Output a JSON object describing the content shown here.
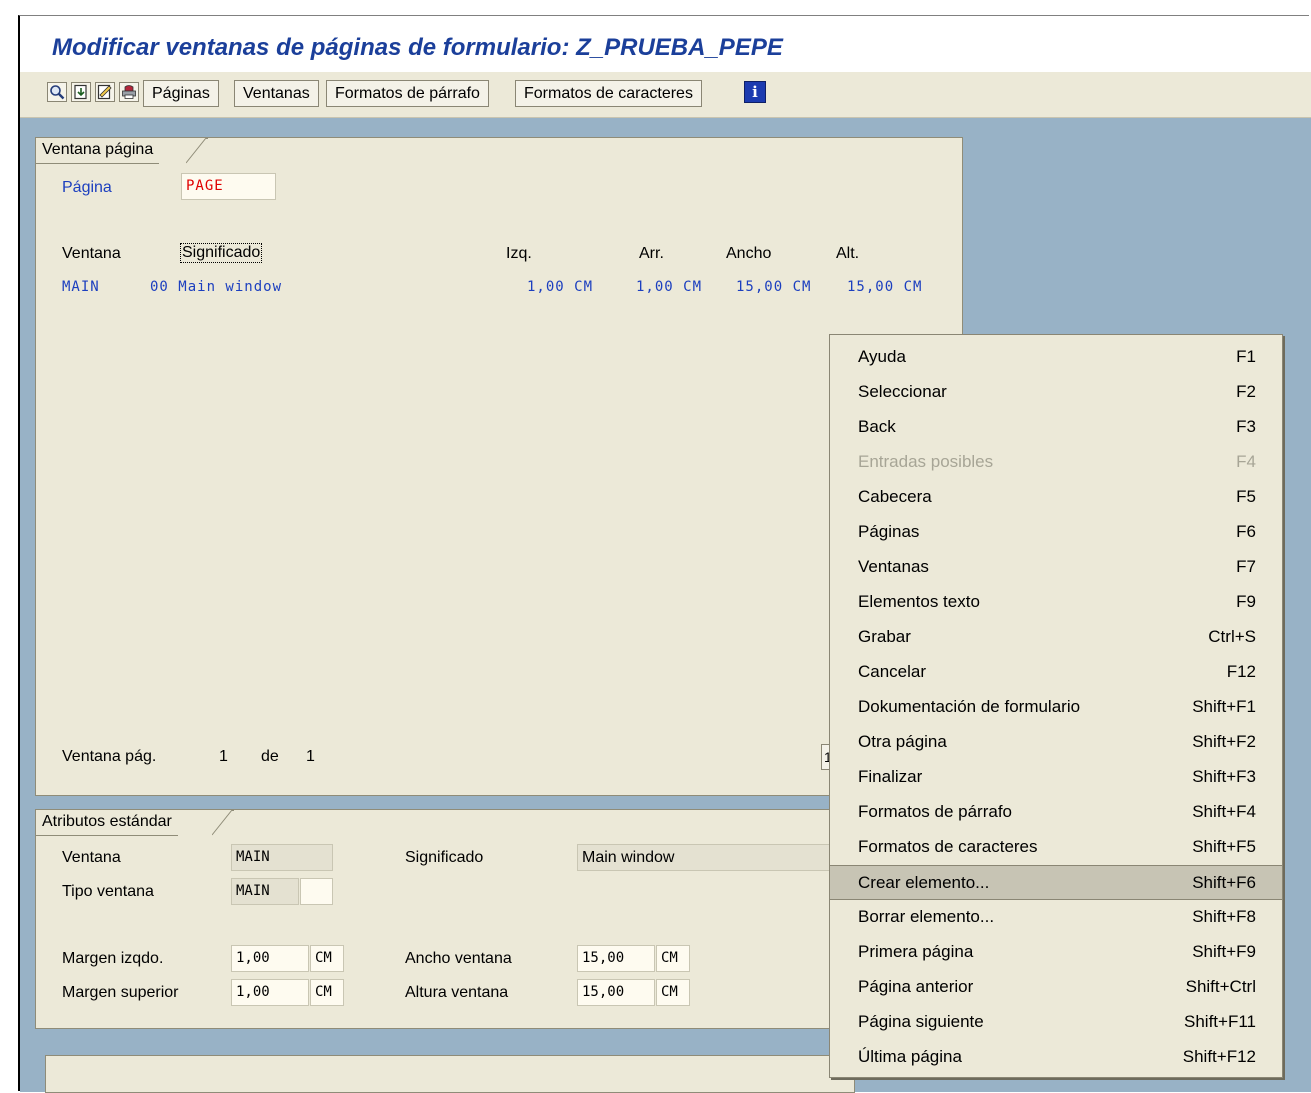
{
  "title": "Modificar ventanas de páginas de formulario: Z_PRUEBA_PEPE",
  "toolbar": {
    "buttons": [
      "Páginas",
      "Ventanas",
      "Formatos de párrafo",
      "Formatos de caracteres"
    ],
    "icons": [
      "magnifier-icon",
      "save-document-icon",
      "edit-pencil-icon",
      "print-icon",
      "info-icon"
    ],
    "info_glyph": "i"
  },
  "page_window": {
    "tab_label": "Ventana página",
    "page_label": "Página",
    "page_value": "PAGE",
    "headers": {
      "ventana": "Ventana",
      "significado": "Significado",
      "izq": "Izq.",
      "arr": "Arr.",
      "ancho": "Ancho",
      "alt": "Alt."
    },
    "rows": [
      {
        "ventana": "MAIN",
        "significado": "00 Main window",
        "izq": "1,00 CM",
        "arr": "1,00 CM",
        "ancho": "15,00 CM",
        "alt": "15,00 CM"
      }
    ],
    "pager": {
      "label": "Ventana pág.",
      "current": "1",
      "of": "de",
      "total": "1"
    },
    "partial_button": "1"
  },
  "attributes": {
    "tab_label": "Atributos estándar",
    "ventana_label": "Ventana",
    "ventana_value": "MAIN",
    "significado_label": "Significado",
    "significado_value": "Main window",
    "tipo_label": "Tipo ventana",
    "tipo_value": "MAIN",
    "margen_izq_label": "Margen izqdo.",
    "margen_izq_value": "1,00",
    "margen_izq_unit": "CM",
    "margen_sup_label": "Margen superior",
    "margen_sup_value": "1,00",
    "margen_sup_unit": "CM",
    "ancho_label": "Ancho ventana",
    "ancho_value": "15,00",
    "ancho_unit": "CM",
    "altura_label": "Altura ventana",
    "altura_value": "15,00",
    "altura_unit": "CM"
  },
  "context_menu": {
    "items": [
      {
        "label": "Ayuda",
        "key": "F1"
      },
      {
        "label": "Seleccionar",
        "key": "F2"
      },
      {
        "label": "Back",
        "key": "F3"
      },
      {
        "label": "Entradas posibles",
        "key": "F4",
        "disabled": true
      },
      {
        "label": "Cabecera",
        "key": "F5"
      },
      {
        "label": "Páginas",
        "key": "F6"
      },
      {
        "label": "Ventanas",
        "key": "F7"
      },
      {
        "label": "Elementos texto",
        "key": "F9"
      },
      {
        "label": "Grabar",
        "key": "Ctrl+S"
      },
      {
        "label": "Cancelar",
        "key": "F12"
      },
      {
        "label": "Dokumentación de formulario",
        "key": "Shift+F1"
      },
      {
        "label": "Otra página",
        "key": "Shift+F2"
      },
      {
        "label": "Finalizar",
        "key": "Shift+F3"
      },
      {
        "label": "Formatos de párrafo",
        "key": "Shift+F4"
      },
      {
        "label": "Formatos de caracteres",
        "key": "Shift+F5"
      },
      {
        "label": "Crear elemento...",
        "key": "Shift+F6",
        "selected": true
      },
      {
        "label": "Borrar elemento...",
        "key": "Shift+F8"
      },
      {
        "label": "Primera página",
        "key": "Shift+F9"
      },
      {
        "label": "Página anterior",
        "key": "Shift+Ctrl"
      },
      {
        "label": "Página siguiente",
        "key": "Shift+F11"
      },
      {
        "label": "Última página",
        "key": "Shift+F12"
      }
    ]
  },
  "colors": {
    "title": "#1b3f9a",
    "panel_bg": "#ece9d8",
    "screen_bg": "#98b2c6",
    "link_blue": "#1c3fbf",
    "page_value_red": "#e00000"
  }
}
